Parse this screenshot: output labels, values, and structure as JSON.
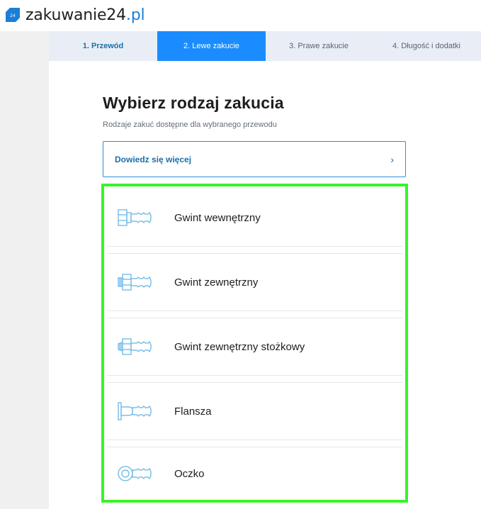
{
  "brand": {
    "name_main": "zakuwanie24",
    "name_tld": ".pl",
    "accent_color": "#1a7fd6"
  },
  "steps": [
    {
      "label": "1. Przewód",
      "state": "done"
    },
    {
      "label": "2. Lewe zakucie",
      "state": "active"
    },
    {
      "label": "3. Prawe zakucie",
      "state": "pending"
    },
    {
      "label": "4. Długość i dodatki",
      "state": "pending"
    }
  ],
  "main": {
    "title": "Wybierz rodzaj zakucia",
    "subtitle": "Rodzaje zakuć dostępne dla wybranego przewodu",
    "learn_more": {
      "label": "Dowiedz się więcej",
      "icon": "chevron-right-icon"
    }
  },
  "options": [
    {
      "label": "Gwint wewnętrzny",
      "icon": "internal-thread-fitting-icon"
    },
    {
      "label": "Gwint zewnętrzny",
      "icon": "external-thread-fitting-icon"
    },
    {
      "label": "Gwint zewnętrzny stożkowy",
      "icon": "tapered-thread-fitting-icon"
    },
    {
      "label": "Flansza",
      "icon": "flange-fitting-icon"
    },
    {
      "label": "Oczko",
      "icon": "eye-fitting-icon"
    }
  ],
  "colors": {
    "active_step": "#1a8cff",
    "highlight_border": "#39f32b",
    "line_icon": "#5fb2e6"
  }
}
